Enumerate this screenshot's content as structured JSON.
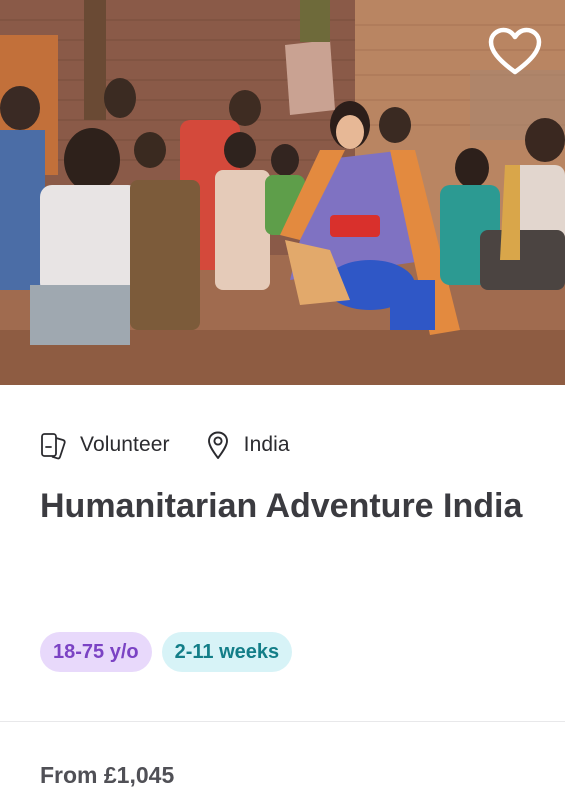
{
  "card": {
    "image_alt": "Volunteer crouching with a group of children in a village in India",
    "favorite_icon": "heart-icon",
    "category": {
      "icon": "phone-cards-icon",
      "label": "Volunteer"
    },
    "location": {
      "icon": "map-pin-icon",
      "label": "India"
    },
    "title": "Humanitarian Adventure India",
    "tags": [
      {
        "label": "18-75 y/o",
        "color": "#7b43c4",
        "bg": "#e8d9fb"
      },
      {
        "label": "2-11 weeks",
        "color": "#137e88",
        "bg": "#d7f3f7"
      }
    ],
    "price": "From £1,045"
  }
}
